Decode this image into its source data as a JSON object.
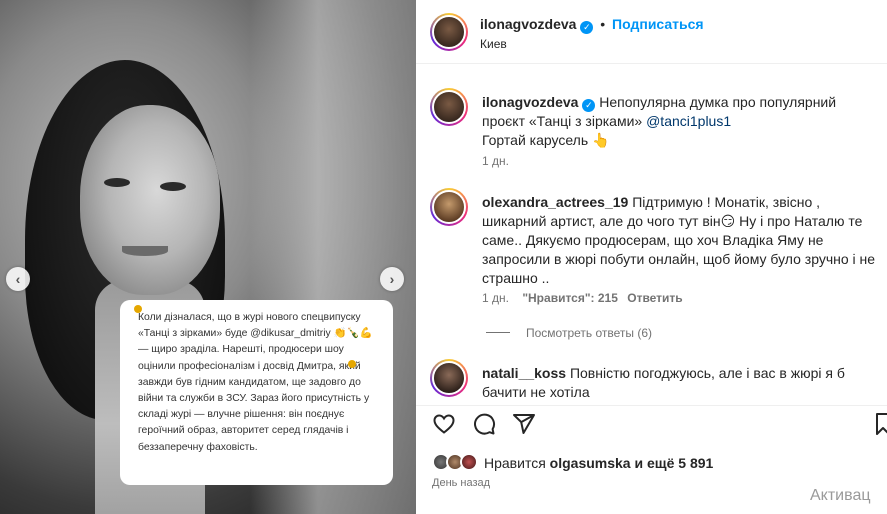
{
  "post": {
    "caption_card_text": "Коли дізналася, що в журі нового спецвипуску «Танці з зірками» буде @dikusar_dmitriy 👏🍾💪 — щиро зраділа. Нарешті, продюсери шоу оцінили професіоналізм і досвід Дмитра, який завжди був гідним кандидатом, ще задовго до війни та служби в ЗСУ. Зараз його присутність у складі журі — влучне рішення: він поєднує героїчний образ, авторитет серед глядачів і беззаперечну фаховість.",
    "nav_prev": "‹",
    "nav_next": "›"
  },
  "header": {
    "username": "ilonagvozdeva",
    "verified": "✓",
    "follow_label": "Подписаться",
    "location": "Киев",
    "more": "···"
  },
  "caption": {
    "username": "ilonagvozdeva",
    "text_a": "Непопулярна думка про популярний проєкт «Танці з зірками» ",
    "mention": "@tanci1plus1",
    "text_b": "Гортай карусель 👆",
    "time": "1 дн."
  },
  "comments": [
    {
      "username": "olexandra_actrees_19",
      "text": " Підтримую ! Монатік, звісно , шикарний артист, але до чого тут він😏 Ну і про Наталю те саме.. Дякуємо продюсерам, що хоч Владіка Яму не запросили в жюрі побути онлайн, щоб йому було зручно і не страшно ..",
      "time": "1 дн.",
      "likes": "\"Нравится\": 215",
      "reply": "Ответить",
      "view_replies": "Посмотреть ответы (6)"
    },
    {
      "username": "natali__koss",
      "text": " Повністю погоджуюсь, але і вас в жюрі я б бачити не хотіла"
    }
  ],
  "likes": {
    "prefix": "Нравится ",
    "user": "olgasumska",
    "suffix": " и ещё 5 891"
  },
  "time_ago": "День назад",
  "watermark": "Активац",
  "icons": [
    "heart-icon",
    "comment-icon",
    "share-icon",
    "bookmark-icon",
    "chevron-left-icon",
    "chevron-right-icon",
    "more-icon"
  ]
}
